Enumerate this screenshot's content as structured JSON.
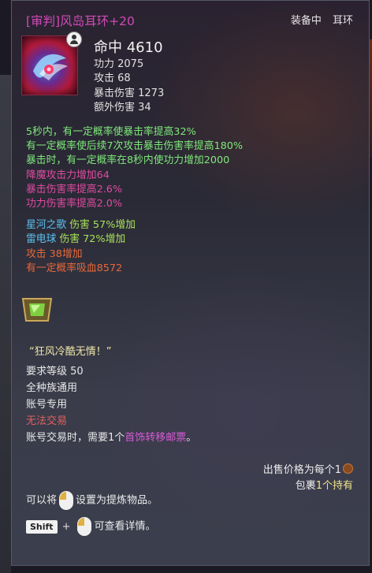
{
  "tooltip": {
    "title": "[审判]风岛耳环+20",
    "equipped_label": "装备中",
    "slot_label": "耳环",
    "main_stat": "命中 4610",
    "sub_stats": [
      "功力 2075",
      "攻击 68",
      "暴击伤害 1273",
      "额外伤害 34"
    ],
    "effects_green": [
      "5秒内，有一定概率使暴击率提高32%",
      "有一定概率使后续7次攻击暴击伤害率提高180%",
      "暴击时，有一定概率在8秒内使功力增加2000"
    ],
    "effects_pink": [
      "降魔攻击力增加64",
      "暴击伤害率提高2.6%",
      "功力伤害率提高2.0%"
    ],
    "set_effects": [
      {
        "name": "星河之歌",
        "text": " 伤害 57%增加"
      },
      {
        "name": "雷电球",
        "text": " 伤害 72%增加"
      }
    ],
    "bonus_effects": [
      "攻击 38增加",
      "有一定概率吸血8572"
    ],
    "quote": "“狂风冷酷无情！”",
    "info_lines": [
      "要求等级 50",
      "全种族通用",
      "账号专用"
    ],
    "no_trade": "无法交易",
    "trade_note_prefix": "账号交易时，需要1个",
    "trade_note_link": "首饰转移邮票",
    "trade_note_suffix": "。",
    "sell_price": "出售价格为每个1",
    "bag_prefix": "包裹",
    "bag_count": "1个持有",
    "refine_prefix": "可以将",
    "refine_suffix": "设置为提炼物品。",
    "shift_key": "Shift",
    "plus": "+",
    "detail_suffix": "可查看详情。"
  },
  "icons": [
    "earring-icon",
    "character-badge-icon",
    "gem-socket-icon",
    "coin-icon",
    "mouse-icon"
  ],
  "colors": {
    "title": "#d24ab8",
    "green": "#7ee87a",
    "pink": "#e04aa0",
    "blue": "#5bc0f0",
    "orange": "#e8683a",
    "quote": "#f0e6a8"
  }
}
